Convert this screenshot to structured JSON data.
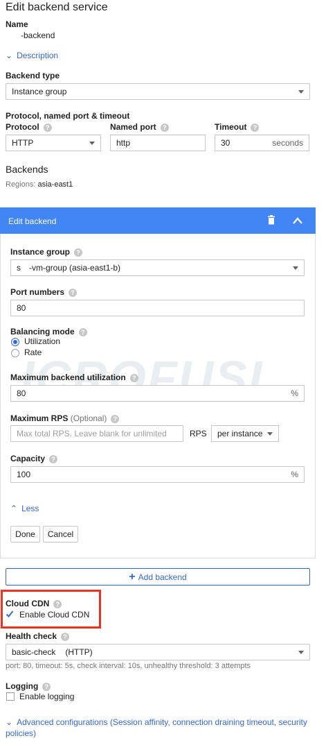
{
  "page": {
    "title": "Edit backend service"
  },
  "name": {
    "label": "Name",
    "value": "-backend"
  },
  "description_link": "Description",
  "backend_type": {
    "label": "Backend type",
    "value": "Instance group"
  },
  "protocol_section": {
    "heading": "Protocol, named port & timeout",
    "protocol_label": "Protocol",
    "protocol_value": "HTTP",
    "named_port_label": "Named port",
    "named_port_value": "http",
    "timeout_label": "Timeout",
    "timeout_value": "30",
    "timeout_unit": "seconds"
  },
  "backends": {
    "heading": "Backends",
    "regions_label": "Regions:",
    "regions_value": "asia-east1"
  },
  "edit_backend": {
    "header": "Edit backend",
    "instance_group_label": "Instance group",
    "instance_group_prefix": "s",
    "instance_group_value": "-vm-group (asia-east1-b)",
    "port_numbers_label": "Port numbers",
    "port_numbers_value": "80",
    "balancing_mode_label": "Balancing mode",
    "mode_utilization": "Utilization",
    "mode_rate": "Rate",
    "max_util_label": "Maximum backend utilization",
    "max_util_value": "80",
    "percent": "%",
    "max_rps_label": "Maximum RPS",
    "max_rps_optional": "(Optional)",
    "max_rps_placeholder": "Max total RPS. Leave blank for unlimited",
    "rps_label": "RPS",
    "rps_scope": "per instance",
    "capacity_label": "Capacity",
    "capacity_value": "100",
    "less_link": "Less",
    "done_button": "Done",
    "cancel_button": "Cancel"
  },
  "add_backend_button": "Add backend",
  "cloud_cdn": {
    "label": "Cloud CDN",
    "checkbox_label": "Enable Cloud CDN",
    "highlight_color": "#ea3323"
  },
  "health_check": {
    "label": "Health check",
    "value": "basic-check",
    "value_suffix": "(HTTP)",
    "details": "port: 80, timeout: 5s, check interval: 10s, unhealthy threshold: 3 attempts"
  },
  "logging": {
    "label": "Logging",
    "checkbox_label": "Enable logging"
  },
  "advanced_link": "Advanced configurations (Session affinity, connection draining timeout, security policies)",
  "watermark": "ICROFUSI",
  "colors": {
    "accent": "#3367d6",
    "header_bg": "#4285f4"
  },
  "icons": {
    "delete": "trash-icon",
    "collapse": "chevron-up-icon",
    "expand": "chevron-down-icon",
    "help": "help-icon",
    "add": "plus-icon",
    "check": "checkmark-icon"
  }
}
